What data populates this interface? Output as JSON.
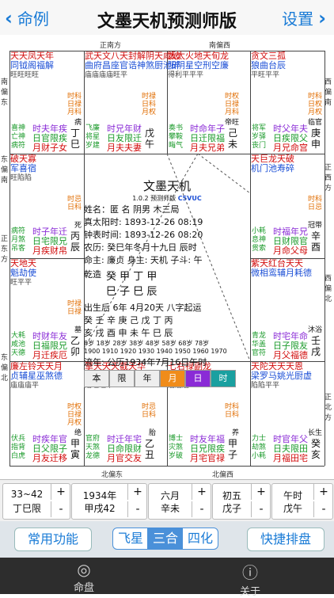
{
  "nav": {
    "back_label": "命例",
    "title": "文墨天机预测师版",
    "settings_label": "设置"
  },
  "directions": {
    "top_left": "正南方",
    "top_right": "南偏西",
    "right_upper": "西偏南",
    "right_mid": "正西方",
    "right_lower": "西偏北",
    "bottom_right": "北偏西",
    "bottom_left": "北偏东",
    "bottom_mid": "正北方",
    "left_lower": "东偏北",
    "left_mid": "正东方",
    "left_upper": "东偏南",
    "left_top": "南偏东"
  },
  "palaces": [
    {
      "stars": "天天凤天年\n同钺阁福解",
      "status": "旺旺旺旺",
      "small": "病",
      "shen": "喜神\n亡神\n病符",
      "label": "时夫年疾\n日官限疾\n月财子女",
      "gz": "丁巳",
      "sub": "时科\n日禄\n月科"
    },
    {
      "stars": "武天文八天封解阴天咸破\n曲府昌座官诰神煞厨池碎",
      "status": "庙庙庙庙旺平",
      "small": "",
      "shen": "飞廉\n将星\n岁建",
      "label": "时兄年财\n日友限迁\n月夫夫妻",
      "gz": "戊午",
      "sub": "时禄\n日科\n月权"
    },
    {
      "stars": "太太火地天旬龙\n阳阴星空刑空廉",
      "status": "得利平平平",
      "small": "帝旺",
      "shen": "奏书\n攀鞍\n晦气",
      "label": "时命年子\n日迁限福\n月夫兄弟",
      "gz": "己未",
      "sub": "时权\n日禄\n月科"
    },
    {
      "stars": "贪文三孤\n狼曲台辰",
      "status": "平旺平平",
      "small": "临官",
      "shen": "将军\n岁驿\n丧门",
      "label": "时父年夫\n日疾限父\n月兄命宫",
      "gz": "庚申",
      "sub": "时科\n日权\n月权"
    },
    {
      "stars": "破天寡\n军喜宿",
      "status": "旺陷陷",
      "small": "死",
      "shen": "病符\n月煞\n吊客",
      "label": "时子年迁\n日宅限兄\n月疾财帛",
      "gz": "丙辰",
      "sub": "时忌\n日科"
    },
    {
      "stars": "天巨龙天破\n机门池寿碎",
      "status": "",
      "small": "冠带",
      "shen": "小耗\n息神\n贯索",
      "label": "时福年兄\n日财限官\n月命父母",
      "gz": "辛酉",
      "sub": "时科\n日忌"
    },
    {
      "stars": "天地天\n魁劫使",
      "status": "旺平平",
      "small": "墓",
      "shen": "大耗\n咸池\n天德",
      "label": "时财年友\n日福限兄\n月迁疾厄",
      "gz": "乙卯",
      "sub": "时禄\n日禄"
    },
    {
      "stars": "紫天红台天天\n微相鸾辅月耗德",
      "status": "",
      "small": "沐浴",
      "shen": "青龙\n华盖\n官符",
      "label": "时宅年命\n日子限友\n月父福德",
      "gz": "壬戌",
      "sub": ""
    },
    {
      "stars": "廉左铃天天月\n贞辅星巫煞德",
      "status": "庙庙庙平",
      "small": "绝",
      "shen": "伏兵\n指背\n白虎",
      "label": "时疾年官\n日父限子\n月友迁移",
      "gz": "甲寅",
      "sub": "时权\n日禄\n月权"
    },
    {
      "stars": "擎天天天截天华\n羊贵才伤空哭盖",
      "status": "陷旺旺平",
      "small": "胎",
      "shen": "官府\n天煞\n龙德",
      "label": "时迁年宅\n日命限财\n月官交友",
      "gz": "乙丑",
      "sub": "时忌\n日科"
    },
    {
      "stars": "七右禄副龙\n杀弼存截德",
      "status": "庙庙庙",
      "small": "养",
      "shen": "博士\n灾煞\n岁破",
      "label": "时友年福\n日兄限疾\n月宅官禄",
      "gz": "甲子",
      "sub": "时科\n日科"
    },
    {
      "stars": "天陀天天天恩\n梁罗马姚光厨虚",
      "status": "陷陷平平",
      "small": "长生",
      "shen": "力士\n劫煞\n小耗",
      "label": "时官年父\n日夫限田\n月福田宅",
      "gz": "癸亥",
      "sub": ""
    }
  ],
  "center": {
    "app_title": "文墨天机",
    "version": "1.0.2 预测师版",
    "code": "C5VUC",
    "name_line": "姓名：匿 名     阴男 木三局",
    "solar_time": "真太阳时: 1893-12-26  08:19",
    "clock_time": "钟表时间: 1893-12-26  08:20",
    "lunar_time": "农历: 癸巳年冬月十九日 辰时",
    "ming_zhu": "命主: 廉贞 身主: 天机 子斗: 午",
    "qianzao": "乾造",
    "bazi_top": "癸    甲    丁    甲",
    "bazi_bot": "巳    子    巳    辰",
    "qiyun": "出生后 6年 4月20天 八字起运",
    "dayun_top": "癸  壬  辛  庚  己  戊  丁  丙",
    "dayun_bot": "亥  戌  酉  申  未  午  巳  辰",
    "dayun_age": "8岁 18岁 28岁 38岁 48岁 58岁 68岁 78岁",
    "dayun_year": "1900 1910 1920 1930 1940 1950 1960 1970",
    "liunian": "流年: 公历1934年7月16日午时",
    "tabs": [
      "本",
      "限",
      "年",
      "月",
      "日",
      "时"
    ]
  },
  "selectors": [
    {
      "top": "33~42",
      "bot": "丁巳限"
    },
    {
      "top": "1934年",
      "bot": "甲戌42"
    },
    {
      "top": "六月",
      "bot": "辛未"
    },
    {
      "top": "初五",
      "bot": "戊子"
    },
    {
      "top": "午时",
      "bot": "戊午"
    }
  ],
  "func": {
    "left": "常用功能",
    "seg": [
      "飞星",
      "三合",
      "四化"
    ],
    "right": "快捷排盘"
  },
  "tabbar": {
    "tab1": "命盘",
    "tab2": "关于"
  },
  "colors": {
    "accent": "#1a7bd6",
    "seg_active": "#4a90d9",
    "tab_bg": "#2d2d2d"
  }
}
